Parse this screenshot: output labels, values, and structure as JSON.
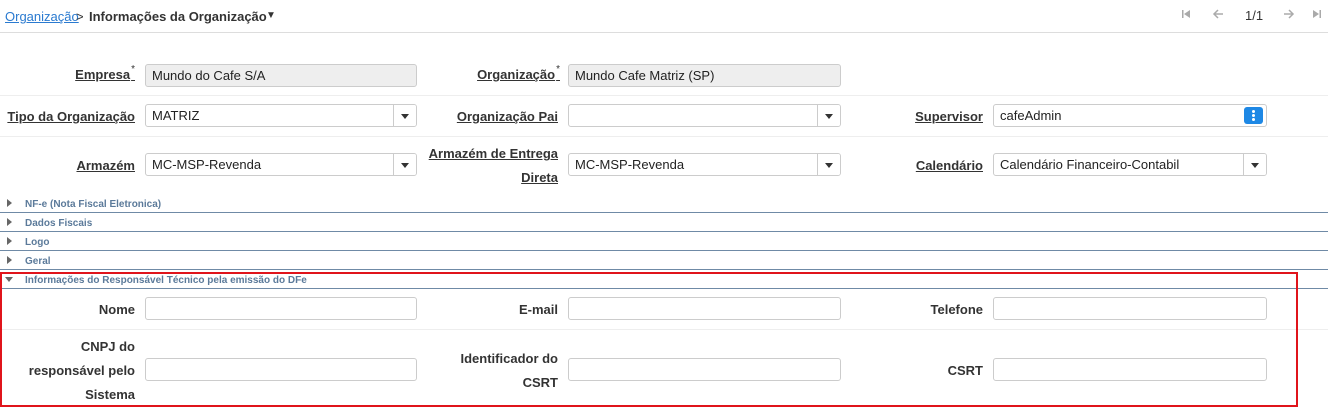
{
  "breadcrumb": {
    "parent": "Organização",
    "separator": ">",
    "current": "Informações da Organização"
  },
  "pager": {
    "indicator": "1/1",
    "first": "⏮",
    "prev": "←",
    "next": "→",
    "last": "⏭"
  },
  "form": {
    "empresa": {
      "label": "Empresa",
      "required": "*",
      "value": "Mundo do Cafe S/A"
    },
    "organizacao": {
      "label": "Organização",
      "required": "*",
      "value": "Mundo Cafe Matriz (SP)"
    },
    "tipo": {
      "label": "Tipo da Organização",
      "value": "MATRIZ"
    },
    "org_pai": {
      "label": "Organização Pai",
      "value": ""
    },
    "supervisor": {
      "label": "Supervisor",
      "value": "cafeAdmin"
    },
    "armazem": {
      "label": "Armazém",
      "value": "MC-MSP-Revenda"
    },
    "armazem_entrega_1": "Armazém de Entrega",
    "armazem_entrega_2": "Direta",
    "armazem_entrega_value": "MC-MSP-Revenda",
    "calendario": {
      "label": "Calendário",
      "value": "Calendário Financeiro-Contabil"
    }
  },
  "sections": [
    {
      "label": "NF-e (Nota Fiscal Eletronica)"
    },
    {
      "label": "Dados Fiscais"
    },
    {
      "label": "Logo"
    },
    {
      "label": "Geral"
    },
    {
      "label": "Informações do Responsável Técnico pela emissão do DFe"
    }
  ],
  "responsavel": {
    "nome": "Nome",
    "email": "E-mail",
    "telefone": "Telefone",
    "cnpj_1": "CNPJ do",
    "cnpj_2": "responsável pelo",
    "cnpj_3": "Sistema",
    "ident_1": "Identificador do",
    "ident_2": "CSRT",
    "csrt": "CSRT"
  },
  "colors": {
    "link": "#2a7ad0",
    "section": "#5b7a9a",
    "highlight": "#e0141b",
    "accent": "#1e88e5"
  }
}
